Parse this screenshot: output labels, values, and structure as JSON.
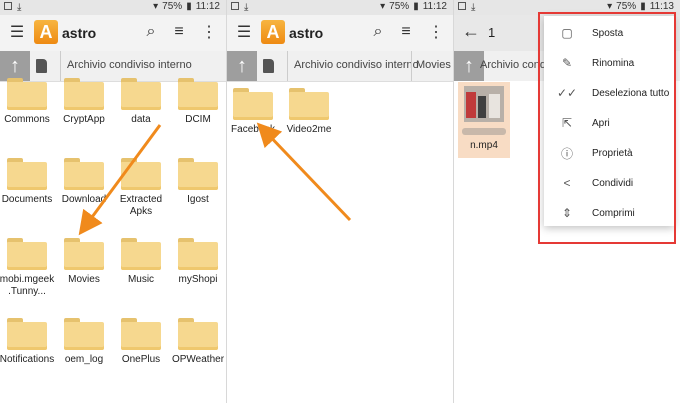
{
  "status": {
    "battery": "75%",
    "time_left": "11:12",
    "time_right": "11:13"
  },
  "app": {
    "title": "astro"
  },
  "path": {
    "storage": "Archivio condiviso interno",
    "movies": "Movies"
  },
  "panel1": {
    "folders": [
      "Commons",
      "CryptApp",
      "data",
      "DCIM",
      "Documents",
      "Download",
      "Extracted Apks",
      "Igost",
      "mobi.mgeek.Tunny...",
      "Movies",
      "Music",
      "myShopi",
      "Notifications",
      "oem_log",
      "OnePlus",
      "OPWeather"
    ]
  },
  "panel2": {
    "folders": [
      "Facebook",
      "Video2me"
    ]
  },
  "panel3": {
    "selection_count": "1",
    "file_name": "n.mp4",
    "menu": [
      {
        "label": "Sposta",
        "icon": "move-icon"
      },
      {
        "label": "Rinomina",
        "icon": "pencil-icon"
      },
      {
        "label": "Deseleziona tutto",
        "icon": "double-check-icon"
      },
      {
        "label": "Apri",
        "icon": "open-external-icon"
      },
      {
        "label": "Proprietà",
        "icon": "info-icon"
      },
      {
        "label": "Condividi",
        "icon": "share-icon"
      },
      {
        "label": "Comprimi",
        "icon": "compress-icon"
      }
    ]
  },
  "colors": {
    "accent": "#f08a1c",
    "highlight": "#e53935",
    "folder": "#f6d88f"
  }
}
